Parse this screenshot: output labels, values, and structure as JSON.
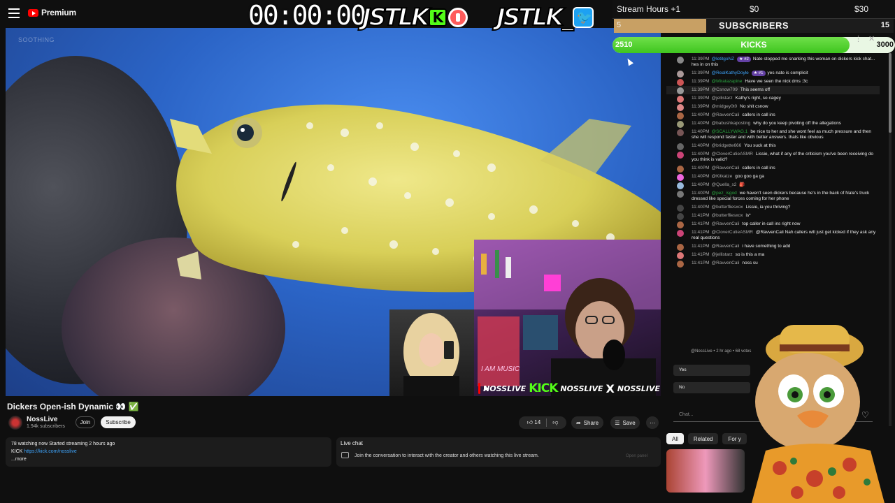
{
  "youtube": {
    "logo_text": "Premium"
  },
  "overlay": {
    "timer": "00:00:00",
    "brand1": "JSTLK",
    "brand1_badge": "K",
    "brand2": "JSTLK_",
    "brand2_badge": "🐦"
  },
  "goal": {
    "stream_hours_label": "Stream Hours +1",
    "stream_hours_min": "$0",
    "stream_hours_max": "$30",
    "subs_label": "SUBSCRIBERS",
    "subs_current": "5",
    "subs_target": "15",
    "subs_progress": 0.33,
    "kicks_label": "KICKS",
    "kicks_current": "2510",
    "kicks_target": "3000",
    "kicks_progress": 0.84,
    "close_glyph": "✕",
    "dots_glyph": "⋮"
  },
  "video": {
    "watermark": "SOOTHING",
    "socials": {
      "handle1": "NOSSLIVE",
      "kick": "KICK",
      "handle2": "NOSSLIVE",
      "x": "X",
      "handle3": "NOSSLIVE"
    },
    "cam_sign": "I AM MUSIC"
  },
  "video_info": {
    "title": "Dickers Open-ish Dynamic 👀 ✅",
    "channel": "NossLive",
    "subscribers": "1.94k subscribers",
    "join": "Join",
    "subscribe": "Subscribe",
    "likes": "14",
    "share": "Share",
    "save": "Save",
    "more": "⋯"
  },
  "description": {
    "stats": "78 watching now  Started streaming 2 hours ago",
    "kick_label": "KICK ",
    "kick_link": "https://kick.com/nosslive",
    "more": "...more"
  },
  "live_chat_panel": {
    "title": "Live chat",
    "text": "Join the conversation to interact with the creator and others watching this live stream.",
    "open_button": "Open panel"
  },
  "chat": {
    "messages": [
      {
        "time": "11:39PM",
        "user": "@letitgoNZ",
        "badge": "#2",
        "text": "Nate stopped me snarking this woman on dickers kick chat... hes in on this",
        "color": "#3ea6ff",
        "avatar": "#888"
      },
      {
        "time": "11:39PM",
        "user": "@RealKathyDoyle",
        "badge": "#1",
        "text": "yes nate is complicit",
        "color": "#3ea6ff",
        "avatar": "#a99"
      },
      {
        "time": "11:39PM",
        "user": "@Miratazapine",
        "badge": "",
        "text": "Have we seen the nick dms :3c",
        "color": "#2ba640",
        "avatar": "#c55"
      },
      {
        "time": "11:39PM",
        "user": "@Csnow709",
        "badge": "",
        "text": "This seems off",
        "color": "#aaa",
        "avatar": "#999"
      },
      {
        "time": "11:39PM",
        "user": "@jellistarz",
        "badge": "",
        "text": "Kathy's right, so cagey",
        "color": "#aaa",
        "avatar": "#d77"
      },
      {
        "time": "11:39PM",
        "user": "@midgey0t0",
        "badge": "",
        "text": "No shit csnow",
        "color": "#aaa",
        "avatar": "#d88"
      },
      {
        "time": "11:40PM",
        "user": "@RavvenCali",
        "badge": "",
        "text": "callers in call ins",
        "color": "#aaa",
        "avatar": "#a64"
      },
      {
        "time": "11:40PM",
        "user": "@babushkaposting",
        "badge": "",
        "text": "why do you keep pivoting off the allegations",
        "color": "#aaa",
        "avatar": "#997"
      },
      {
        "time": "11:40PM",
        "user": "@SCALLYWAG.1",
        "badge": "",
        "text": "be nice to her and she wont feel as much pressure and then she will respond faster and with better answers. thats like obvious",
        "color": "#2ba640",
        "avatar": "#755"
      },
      {
        "time": "11:40PM",
        "user": "@bridgette666",
        "badge": "",
        "text": "You suck at this",
        "color": "#aaa",
        "avatar": "#666"
      },
      {
        "time": "11:40PM",
        "user": "@CloverCutieASMR",
        "badge": "",
        "text": "Lissie, what if any of the criticism you've been receiving do you think is valid?",
        "color": "#aaa",
        "avatar": "#c47"
      },
      {
        "time": "11:40PM",
        "user": "@RavvenCali",
        "badge": "",
        "text": "callers in call ins",
        "color": "#aaa",
        "avatar": "#a64"
      },
      {
        "time": "11:40PM",
        "user": "@Kitkatze",
        "badge": "",
        "text": "goo goo ga ga",
        "color": "#aaa",
        "avatar": "#e6d"
      },
      {
        "time": "11:40PM",
        "user": "@Quella_s2",
        "badge": "",
        "text": "🎒",
        "color": "#aaa",
        "avatar": "#9bd"
      },
      {
        "time": "11:40PM",
        "user": "@pez_isgod",
        "badge": "",
        "text": "we haven't seen dickers because he's in the back of Nate's truck dressed like special forces coming for her phone",
        "color": "#2ba640",
        "avatar": "#777"
      },
      {
        "time": "11:40PM",
        "user": "@butterfliesxox",
        "badge": "",
        "text": "Lissie, ia you thriving?",
        "color": "#aaa",
        "avatar": "#444"
      },
      {
        "time": "11:41PM",
        "user": "@butterfliesxox",
        "badge": "",
        "text": "is*",
        "color": "#aaa",
        "avatar": "#444"
      },
      {
        "time": "11:41PM",
        "user": "@RavvenCali",
        "badge": "",
        "text": "top caller in call ins right now",
        "color": "#aaa",
        "avatar": "#a64"
      },
      {
        "time": "11:41PM",
        "user": "@CloverCutieASMR",
        "badge": "",
        "text": "@RavvenCali Nah callers will just get kicked if they ask any real questions",
        "color": "#aaa",
        "avatar": "#c47"
      },
      {
        "time": "11:41PM",
        "user": "@RavvenCali",
        "badge": "",
        "text": "i have something to add",
        "color": "#aaa",
        "avatar": "#a64"
      },
      {
        "time": "11:41PM",
        "user": "@jellistarz",
        "badge": "",
        "text": "so is this a ma",
        "color": "#aaa",
        "avatar": "#d77"
      },
      {
        "time": "11:41PM",
        "user": "@RavvenCali",
        "badge": "",
        "text": "noss su",
        "color": "#aaa",
        "avatar": "#a64"
      }
    ],
    "poll_header": "@NossLive • 2 hr ago • 68 votes",
    "poll_yes": "Yes",
    "poll_no": "No",
    "input_placeholder": "Chat...",
    "heart": "♡"
  },
  "related_tabs": [
    "All",
    "Related",
    "For y"
  ]
}
